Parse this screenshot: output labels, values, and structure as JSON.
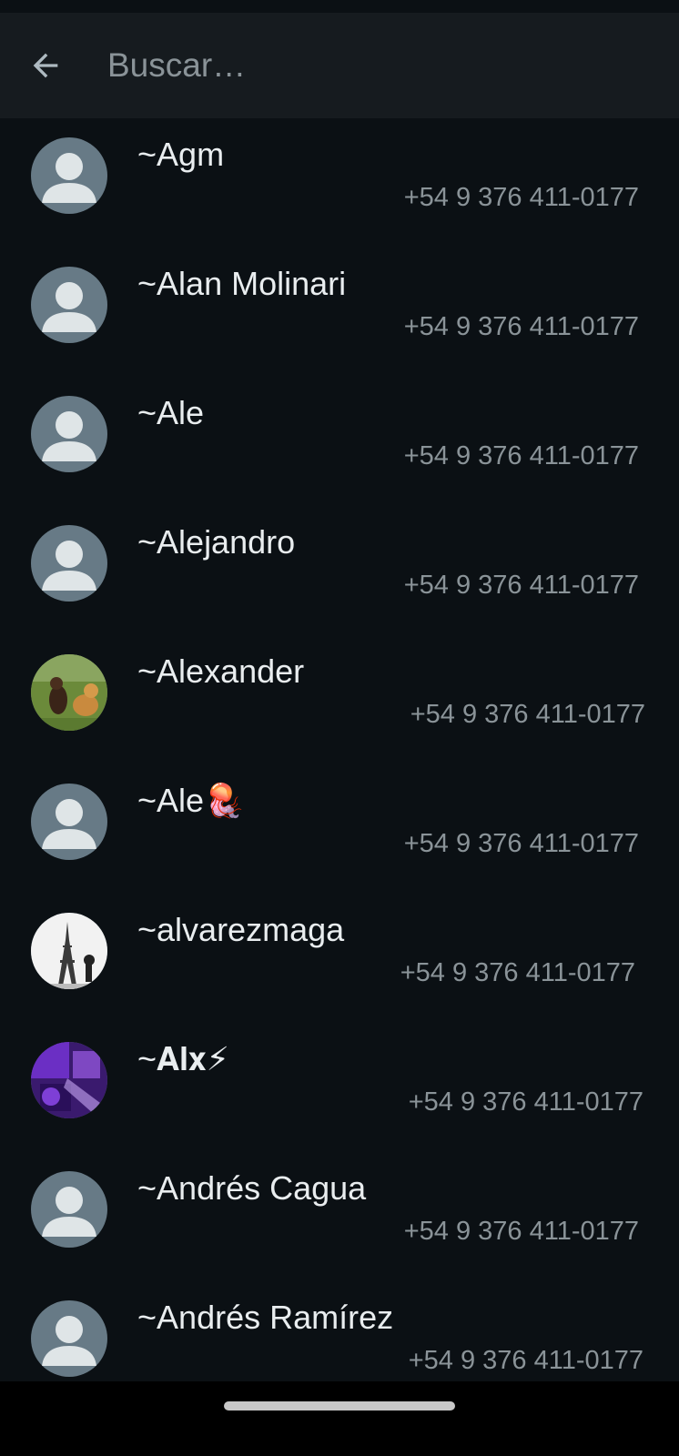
{
  "search": {
    "placeholder": "Buscar…",
    "back_icon": "arrow-left-icon"
  },
  "contacts": [
    {
      "prefix": "~",
      "name": "Agm",
      "phone": "+54 9 376 411-0177",
      "avatar": "default-avatar-icon"
    },
    {
      "prefix": "~",
      "name": "Alan Molinari",
      "phone": "+54 9 376 411-0177",
      "avatar": "default-avatar-icon"
    },
    {
      "prefix": "~",
      "name": "Ale",
      "phone": "+54 9 376 411-0177",
      "avatar": "default-avatar-icon"
    },
    {
      "prefix": "~",
      "name": "Alejandro",
      "phone": "+54 9 376 411-0177",
      "avatar": "default-avatar-icon"
    },
    {
      "prefix": "~",
      "name": "Alexander",
      "phone": "+54 9 376 411-0177",
      "avatar": "photo-dogs-on-grass"
    },
    {
      "prefix": "~",
      "name": "Ale🪼",
      "phone": "+54 9 376 411-0177",
      "avatar": "default-avatar-icon"
    },
    {
      "prefix": "~",
      "name": "alvarezmaga",
      "phone": "+54 9 376 411-0177",
      "avatar": "photo-eiffel-tower"
    },
    {
      "prefix": "~",
      "name": "𝐀𝐥𝐱⚡",
      "phone": "+54 9 376 411-0177",
      "avatar": "photo-purple-neon"
    },
    {
      "prefix": "~",
      "name": "Andrés Cagua",
      "phone": "+54 9 376 411-0177",
      "avatar": "default-avatar-icon"
    },
    {
      "prefix": "~",
      "name": "Andrés Ramírez",
      "phone": "+54 9 376 411-0177",
      "avatar": "default-avatar-icon"
    }
  ],
  "colors": {
    "background": "#0b1014",
    "header": "#161b1f",
    "primary_text": "#e9edef",
    "secondary_text": "#8a9398",
    "avatar_bg": "#677a86",
    "avatar_fg": "#dfe5e7"
  }
}
